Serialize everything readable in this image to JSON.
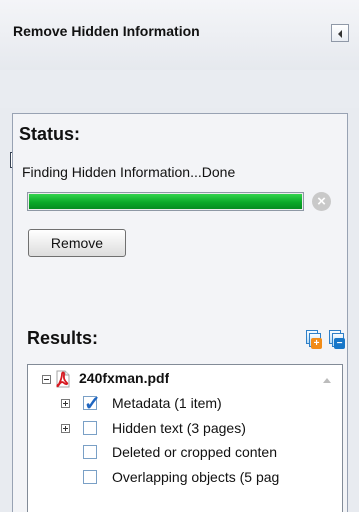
{
  "window": {
    "title": "Remove Hidden Information"
  },
  "toolbar": {
    "options_icon": "list-options-icon"
  },
  "status": {
    "heading": "Status:",
    "message": "Finding Hidden Information...Done",
    "progress_percent": 100,
    "cancel_icon": "cancel-circle-icon",
    "remove_button": "Remove"
  },
  "results": {
    "heading": "Results:",
    "expand_icon": "expand-all-icon",
    "collapse_icon": "collapse-all-icon",
    "items": [
      {
        "label": "240fxman.pdf",
        "type": "file",
        "expanded": true,
        "checked": null,
        "icon": "pdf-icon"
      },
      {
        "label": "Metadata (1 item)",
        "type": "category",
        "expanded": false,
        "checked": true,
        "icon": "checkbox-checked-icon"
      },
      {
        "label": "Hidden text (3 pages)",
        "type": "category",
        "expanded": false,
        "checked": false,
        "icon": "checkbox-icon"
      },
      {
        "label": "Deleted or cropped conten",
        "type": "category",
        "expanded": null,
        "checked": false,
        "icon": "checkbox-icon"
      },
      {
        "label": "Overlapping objects (5 pag",
        "type": "category",
        "expanded": null,
        "checked": false,
        "icon": "checkbox-icon"
      }
    ]
  },
  "colors": {
    "progress_green": "#0aa928",
    "pdf_red": "#d71920",
    "checkbox_blue": "#1f66c1"
  }
}
